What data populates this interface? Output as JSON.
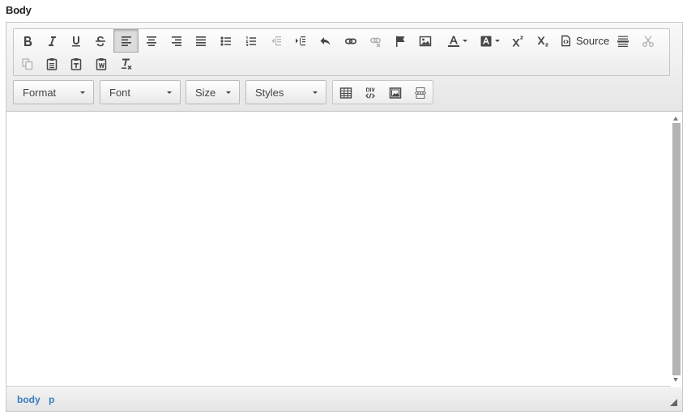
{
  "field": {
    "label": "Body"
  },
  "toolbar": {
    "source_label": "Source",
    "combos": {
      "format": "Format",
      "font": "Font",
      "size": "Size",
      "styles": "Styles"
    }
  },
  "status_path": [
    "body",
    "p"
  ]
}
